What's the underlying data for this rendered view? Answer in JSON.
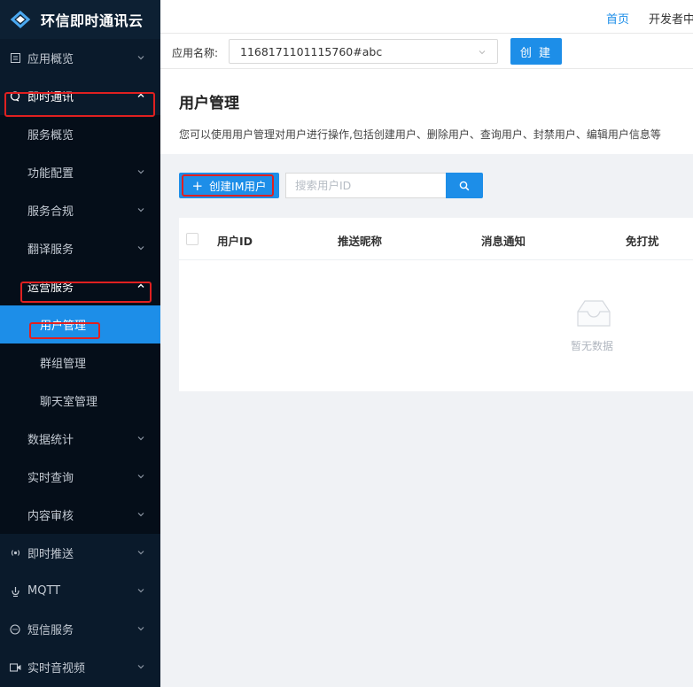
{
  "brand": {
    "title": "环信即时通讯云"
  },
  "topbar": {
    "home": "首页",
    "developer": "开发者中"
  },
  "appbar": {
    "label": "应用名称:",
    "app_value": "1168171101115760#abc",
    "create_label": "创 建"
  },
  "sidebar": {
    "items": [
      {
        "label": "应用概览",
        "icon": "app-overview-icon"
      },
      {
        "label": "即时通讯",
        "icon": "chat-icon"
      },
      {
        "label": "服务概览"
      },
      {
        "label": "功能配置"
      },
      {
        "label": "服务合规"
      },
      {
        "label": "翻译服务"
      },
      {
        "label": "运营服务"
      },
      {
        "label": "用户管理"
      },
      {
        "label": "群组管理"
      },
      {
        "label": "聊天室管理"
      },
      {
        "label": "数据统计"
      },
      {
        "label": "实时查询"
      },
      {
        "label": "内容审核"
      },
      {
        "label": "即时推送",
        "icon": "push-icon"
      },
      {
        "label": "MQTT",
        "icon": "mqtt-icon"
      },
      {
        "label": "短信服务",
        "icon": "sms-icon"
      },
      {
        "label": "实时音视频",
        "icon": "video-icon"
      }
    ]
  },
  "page": {
    "title": "用户管理",
    "description": "您可以使用用户管理对用户进行操作,包括创建用户、删除用户、查询用户、封禁用户、编辑用户信息等"
  },
  "toolbar": {
    "create_user_label": "创建IM用户",
    "search_placeholder": "搜索用户ID"
  },
  "table": {
    "columns": [
      "用户ID",
      "推送昵称",
      "消息通知",
      "免打扰"
    ],
    "empty_text": "暂无数据"
  },
  "colors": {
    "accent": "#1d8ee8",
    "sidebar_bg": "#0a1a2b",
    "highlight": "#e02020"
  }
}
